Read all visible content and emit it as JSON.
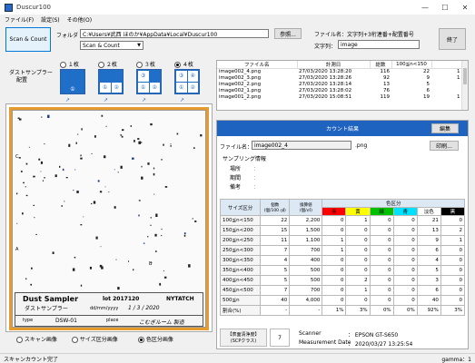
{
  "window": {
    "title": "Duscur100"
  },
  "menu": [
    "ファイル(F)",
    "設定(S)",
    "その他(O)"
  ],
  "toolbar": {
    "scan_count_label": "Scan & Count",
    "folder_label": "フォルダ",
    "folder_path": "C:¥Users¥武西 ほのか¥AppData¥Local¥Duscur100",
    "browse_label": "参照...",
    "mode_selected": "Scan & Count",
    "filename_label": "ファイル名：文字列+3桁連番+配置番号",
    "string_label": "文字列：",
    "string_value": "image",
    "exit_label": "終了"
  },
  "sampler": {
    "label_line1": "ダストサンプラー",
    "label_line2": "配置",
    "options": [
      {
        "label": "１枚",
        "selected": false,
        "cells": [
          "①"
        ]
      },
      {
        "label": "２枚",
        "selected": false,
        "cells": [
          "①",
          "②"
        ]
      },
      {
        "label": "３枚",
        "selected": false,
        "cells": [
          "③",
          "①",
          "②"
        ]
      },
      {
        "label": "４枚",
        "selected": true,
        "cells": [
          "③",
          "④",
          "①",
          "②"
        ]
      }
    ]
  },
  "file_list": {
    "headers": [
      "ファイル名",
      "計測日",
      "総数",
      "100≦n<150",
      ""
    ],
    "rows": [
      [
        "image002_4.png",
        "27/03/2020 13:28:20",
        "116",
        "22",
        "1"
      ],
      [
        "image002_3.png",
        "27/03/2020 13:28:26",
        "92",
        "9",
        "1"
      ],
      [
        "image002_2.png",
        "27/03/2020 13:28:14",
        "13",
        "5",
        ""
      ],
      [
        "image002_1.png",
        "27/03/2020 13:28:02",
        "76",
        "6",
        ""
      ],
      [
        "image001_2.png",
        "27/03/2020 15:08:51",
        "119",
        "19",
        "1"
      ]
    ]
  },
  "sample_card": {
    "title": "Dust Sampler",
    "subtitle": "ダストサンプラー",
    "lot": "lot 2017120",
    "brand": "NYTATCH",
    "date_label": "dd/mm/yyyy",
    "date_value": "1 / 3 / 2020",
    "type_label": "type",
    "type_value": "DSW-01",
    "place_label": "place",
    "place_value": "こむぎルーム 製造",
    "side_marks": [
      "A",
      "B",
      "C"
    ]
  },
  "view_options": [
    {
      "label": "スキャン画像",
      "selected": false
    },
    {
      "label": "サイズ区分画像",
      "selected": false
    },
    {
      "label": "色区分画像",
      "selected": true
    }
  ],
  "result": {
    "header": "カウント結果",
    "edit_label": "編集",
    "file_label": "ファイル名：",
    "file_value": "image002_4",
    "file_ext": ".png",
    "print_label": "印刷...",
    "sampling_title": "サンプリング情報",
    "sampling_fields": [
      {
        "label": "場所",
        "value": "："
      },
      {
        "label": "期間",
        "value": "："
      },
      {
        "label": "備考",
        "value": "："
      }
    ],
    "table": {
      "size_header": "サイズ区分",
      "count_header": "個数\n(個/100 ㎠)",
      "area_header": "換算値\n(個/㎡)",
      "color_header": "色区分",
      "colors": [
        {
          "name": "赤",
          "bg": "#ff0000",
          "fg": "#000000"
        },
        {
          "name": "黄",
          "bg": "#ffff00",
          "fg": "#000000"
        },
        {
          "name": "緑",
          "bg": "#00c000",
          "fg": "#000000"
        },
        {
          "name": "青",
          "bg": "#00e0ff",
          "fg": "#000000"
        },
        {
          "name": "淡色",
          "bg": "#ffffff",
          "fg": "#000000"
        },
        {
          "name": "黒",
          "bg": "#000000",
          "fg": "#ffffff"
        }
      ],
      "rows": [
        {
          "size": "100≦n<150",
          "count": "22",
          "conv": "2,200",
          "c": [
            "0",
            "1",
            "0",
            "0",
            "21",
            "0"
          ]
        },
        {
          "size": "150≦n<200",
          "count": "15",
          "conv": "1,500",
          "c": [
            "0",
            "0",
            "0",
            "0",
            "13",
            "2"
          ]
        },
        {
          "size": "200≦n<250",
          "count": "11",
          "conv": "1,100",
          "c": [
            "1",
            "0",
            "0",
            "0",
            "9",
            "1"
          ]
        },
        {
          "size": "250≦n<300",
          "count": "7",
          "conv": "700",
          "c": [
            "1",
            "0",
            "0",
            "0",
            "6",
            "0"
          ]
        },
        {
          "size": "300≦n<350",
          "count": "4",
          "conv": "400",
          "c": [
            "0",
            "0",
            "0",
            "0",
            "4",
            "0"
          ]
        },
        {
          "size": "350≦n<400",
          "count": "5",
          "conv": "500",
          "c": [
            "0",
            "0",
            "0",
            "0",
            "5",
            "0"
          ]
        },
        {
          "size": "400≦n<450",
          "count": "5",
          "conv": "500",
          "c": [
            "0",
            "2",
            "0",
            "0",
            "3",
            "0"
          ]
        },
        {
          "size": "450≦n<500",
          "count": "7",
          "conv": "700",
          "c": [
            "0",
            "1",
            "0",
            "0",
            "6",
            "0"
          ]
        },
        {
          "size": "500≦n",
          "count": "40",
          "conv": "4,000",
          "c": [
            "0",
            "0",
            "0",
            "0",
            "40",
            "0"
          ]
        },
        {
          "size": "割合(%)",
          "count": "-",
          "conv": "-",
          "c": [
            "1%",
            "3%",
            "0%",
            "0%",
            "92%",
            "3%"
          ]
        }
      ]
    },
    "footer": {
      "cleanliness_label": "【表面清浄度】\n(SCPクラス)",
      "cleanliness_value": "7",
      "scanner_label": "Scanner",
      "scanner_value": "：  EPSON GT-S650",
      "date_label": "Measurement Date",
      "date_value": "：  2020/03/27 13:25:54"
    }
  },
  "status": {
    "left": "スキャンカウント完了",
    "right": "gamma：1"
  }
}
